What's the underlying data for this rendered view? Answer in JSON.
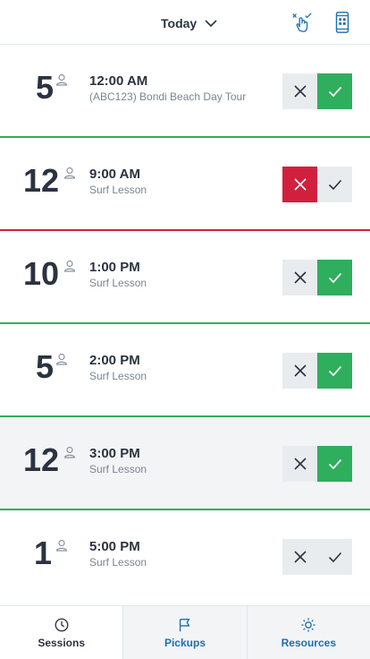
{
  "header": {
    "date_label": "Today",
    "icons": [
      "chevron-down-icon",
      "tap-check-icon",
      "mobile-device-icon"
    ]
  },
  "colors": {
    "confirm_green": "#2fae5d",
    "reject_red": "#d1203e",
    "neutral_button": "#e9ecef",
    "divider_green": "#2fae5d",
    "divider_red": "#d1203e",
    "link_blue": "#1a6fb0"
  },
  "sessions": [
    {
      "count": "5",
      "time": "12:00 AM",
      "name": "(ABC123) Bondi Beach Day Tour",
      "status": "confirmed",
      "divider": "green",
      "shaded": false
    },
    {
      "count": "12",
      "time": "9:00 AM",
      "name": "Surf Lesson",
      "status": "rejected",
      "divider": "red",
      "shaded": false
    },
    {
      "count": "10",
      "time": "1:00 PM",
      "name": "Surf Lesson",
      "status": "confirmed",
      "divider": "green",
      "shaded": false
    },
    {
      "count": "5",
      "time": "2:00 PM",
      "name": "Surf Lesson",
      "status": "confirmed",
      "divider": "green",
      "shaded": false
    },
    {
      "count": "12",
      "time": "3:00 PM",
      "name": "Surf Lesson",
      "status": "confirmed",
      "divider": "green",
      "shaded": true
    },
    {
      "count": "1",
      "time": "5:00 PM",
      "name": "Surf Lesson",
      "status": "pending",
      "divider": "none",
      "shaded": false
    }
  ],
  "tabs": [
    {
      "label": "Sessions",
      "icon": "clock-icon",
      "selected": true
    },
    {
      "label": "Pickups",
      "icon": "flag-icon",
      "selected": false
    },
    {
      "label": "Resources",
      "icon": "sun-icon",
      "selected": false
    }
  ]
}
